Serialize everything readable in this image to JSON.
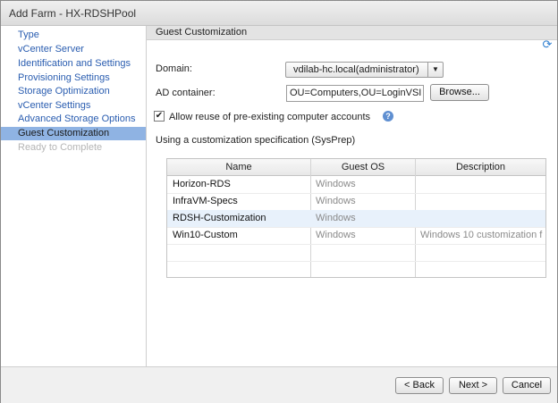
{
  "window": {
    "title": "Add Farm - HX-RDSHPool"
  },
  "nav": {
    "items": [
      {
        "label": "Type",
        "state": "link"
      },
      {
        "label": "vCenter Server",
        "state": "link"
      },
      {
        "label": "Identification and Settings",
        "state": "link"
      },
      {
        "label": "Provisioning Settings",
        "state": "link"
      },
      {
        "label": "Storage Optimization",
        "state": "link"
      },
      {
        "label": "vCenter Settings",
        "state": "link"
      },
      {
        "label": "Advanced Storage Options",
        "state": "link"
      },
      {
        "label": "Guest Customization",
        "state": "active"
      },
      {
        "label": "Ready to Complete",
        "state": "disabled"
      }
    ]
  },
  "content": {
    "header": "Guest Customization",
    "domain_label": "Domain:",
    "domain_value": "vdilab-hc.local(administrator)",
    "ad_label": "AD container:",
    "ad_value": "OU=Computers,OU=LoginVSI",
    "browse_label": "Browse...",
    "reuse_label": "Allow reuse of pre-existing computer accounts",
    "reuse_checked": true,
    "spec_label": "Using a customization specification (SysPrep)",
    "table": {
      "columns": [
        "Name",
        "Guest OS",
        "Description"
      ],
      "rows": [
        {
          "name": "Horizon-RDS",
          "os": "Windows",
          "desc": ""
        },
        {
          "name": "InfraVM-Specs",
          "os": "Windows",
          "desc": ""
        },
        {
          "name": "RDSH-Customization",
          "os": "Windows",
          "desc": ""
        },
        {
          "name": "Win10-Custom",
          "os": "Windows",
          "desc": "Windows 10 customization f"
        }
      ],
      "selected_index": 2
    }
  },
  "footer": {
    "back": "< Back",
    "next": "Next >",
    "cancel": "Cancel"
  },
  "icons": {
    "refresh": "refresh-icon",
    "help": "help-icon",
    "dropdown": "chevron-down-icon"
  }
}
